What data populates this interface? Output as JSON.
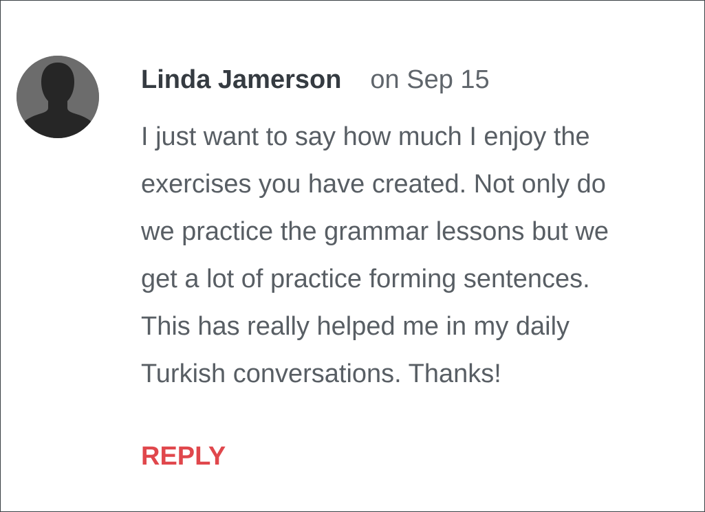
{
  "comment": {
    "author": "Linda Jamerson",
    "date": "on Sep 15",
    "text_lines": [
      "I just want to say how much I enjoy the",
      "exercises you have created. Not only do",
      "we practice the grammar lessons but we",
      "get a lot of practice forming sentences.",
      "This has really helped me in my daily",
      "Turkish conversations. Thanks!"
    ],
    "reply_label": "REPLY",
    "avatar_icon": "default-user-silhouette-icon"
  },
  "colors": {
    "author": "#353b41",
    "date": "#5f656b",
    "body_text": "#585e64",
    "reply_accent": "#e0474c",
    "avatar_bg": "#6c6c6c",
    "avatar_silhouette": "#262626"
  }
}
